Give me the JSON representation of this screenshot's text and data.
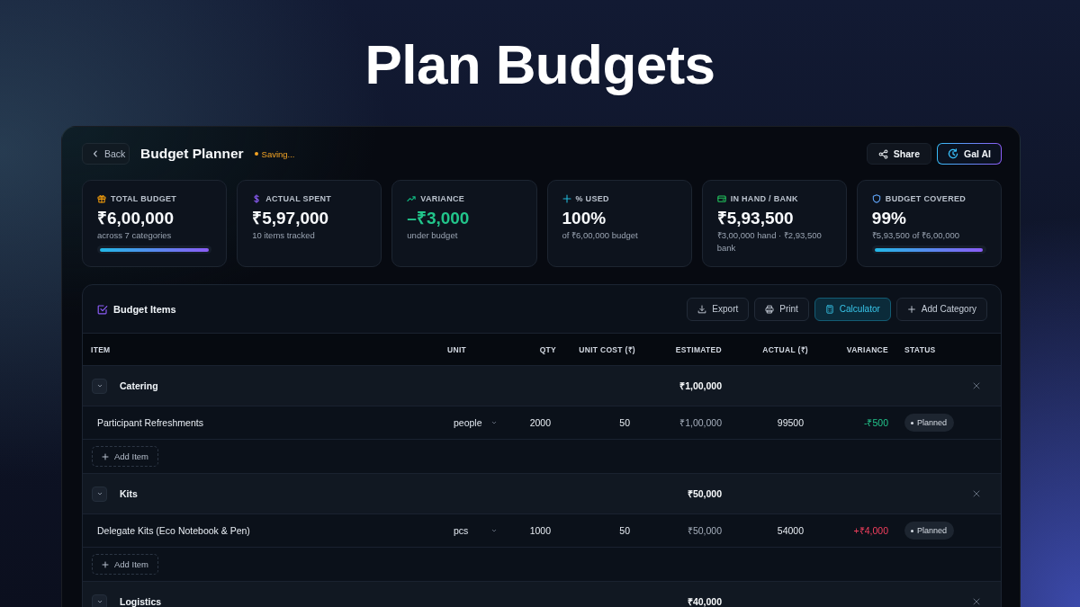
{
  "title": "Plan Budgets",
  "header": {
    "back": "Back",
    "title": "Budget Planner",
    "status": "Saving...",
    "actions": [
      {
        "kind": "share",
        "label": "Share"
      },
      {
        "kind": "ai",
        "label": "Gal AI"
      }
    ]
  },
  "stats": [
    {
      "kind": "total",
      "label": "TOTAL BUDGET",
      "value": "₹6,00,000",
      "note": "across 7 categories",
      "color": "#f8fafc",
      "level": 1
    },
    {
      "kind": "spent",
      "label": "ACTUAL SPENT",
      "value": "₹5,97,000",
      "note": "10 items tracked",
      "color": "#f8fafc"
    },
    {
      "kind": "variance",
      "label": "VARIANCE",
      "value": "–₹3,000",
      "note": "under budget",
      "color": "#22c58b"
    },
    {
      "kind": "used",
      "label": "% USED",
      "value": "100%",
      "note": "of ₹6,00,000 budget",
      "color": "#f8fafc"
    },
    {
      "kind": "cash",
      "label": "IN HAND / BANK",
      "value": "₹5,93,500",
      "note": "₹3,00,000 hand · ₹2,93,500 bank",
      "color": "#f8fafc"
    },
    {
      "kind": "covered",
      "label": "BUDGET COVERED",
      "value": "99%",
      "note": "₹5,93,500 of ₹6,00,000",
      "color": "#f8fafc",
      "level": 0.99
    }
  ],
  "budget": {
    "title": "Budget Items",
    "toolbar": [
      {
        "kind": "export",
        "label": "Export",
        "on": false
      },
      {
        "kind": "print",
        "label": "Print",
        "on": false
      },
      {
        "kind": "calculator",
        "label": "Calculator",
        "on": true
      },
      {
        "kind": "add",
        "label": "Add Category",
        "on": false
      }
    ],
    "columns": [
      "ITEM",
      "UNIT",
      "QTY",
      "UNIT COST (₹)",
      "ESTIMATED",
      "ACTUAL (₹)",
      "VARIANCE",
      "STATUS"
    ],
    "groups": [
      {
        "name": "Catering",
        "total": "₹1,00,000",
        "expanded": true,
        "items": [
          {
            "name": "Participant Refreshments",
            "unit": "people",
            "qty": "2000",
            "unit_cost": "50",
            "estimated": "₹1,00,000",
            "actual": "99500",
            "variance": "-₹500",
            "over_budget": false,
            "status": "Planned"
          }
        ],
        "add_label": "Add Item"
      },
      {
        "name": "Kits",
        "total": "₹50,000",
        "expanded": true,
        "items": [
          {
            "name": "Delegate Kits (Eco Notebook & Pen)",
            "unit": "pcs",
            "qty": "1000",
            "unit_cost": "50",
            "estimated": "₹50,000",
            "actual": "54000",
            "variance": "+₹4,000",
            "over_budget": true,
            "status": "Planned"
          }
        ],
        "add_label": "Add Item"
      },
      {
        "name": "Logistics",
        "total": "₹40,000",
        "expanded": true
      }
    ]
  }
}
